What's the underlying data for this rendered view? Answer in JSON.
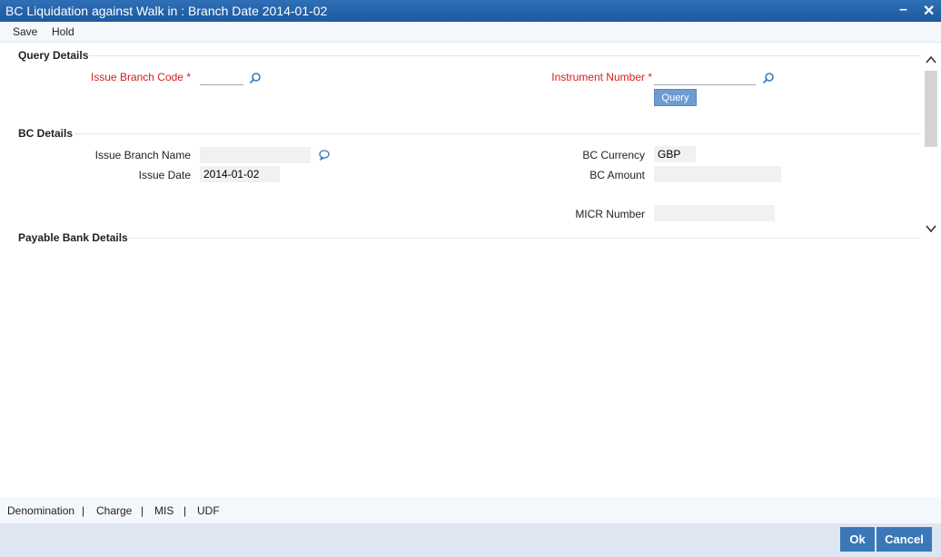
{
  "window": {
    "title": "BC Liquidation against Walk in : Branch Date 2014-01-02",
    "minimize": "–",
    "close": "✕"
  },
  "menu": {
    "save": "Save",
    "hold": "Hold"
  },
  "query_details": {
    "heading": "Query Details",
    "issue_branch_code_label": "Issue Branch Code",
    "instrument_number_label": "Instrument Number",
    "required_mark": "*",
    "issue_branch_code_value": "",
    "instrument_number_value": "",
    "query_button": "Query"
  },
  "bc_details": {
    "heading": "BC Details",
    "issue_branch_name_label": "Issue Branch Name",
    "issue_branch_name_value": "",
    "issue_date_label": "Issue Date",
    "issue_date_value": "2014-01-02",
    "bc_currency_label": "BC Currency",
    "bc_currency_value": "GBP",
    "bc_amount_label": "BC Amount",
    "bc_amount_value": "",
    "micr_number_label": "MICR Number",
    "micr_number_value": ""
  },
  "payable_bank_details": {
    "heading": "Payable Bank Details"
  },
  "bottom_tabs": {
    "denomination": "Denomination",
    "sep": "|",
    "charge": "Charge",
    "mis": "MIS",
    "udf": "UDF"
  },
  "footer": {
    "ok": "Ok",
    "cancel": "Cancel"
  },
  "colors": {
    "titlebar": "#1d5aa0",
    "required": "#d42020",
    "button": "#3a78b8"
  }
}
